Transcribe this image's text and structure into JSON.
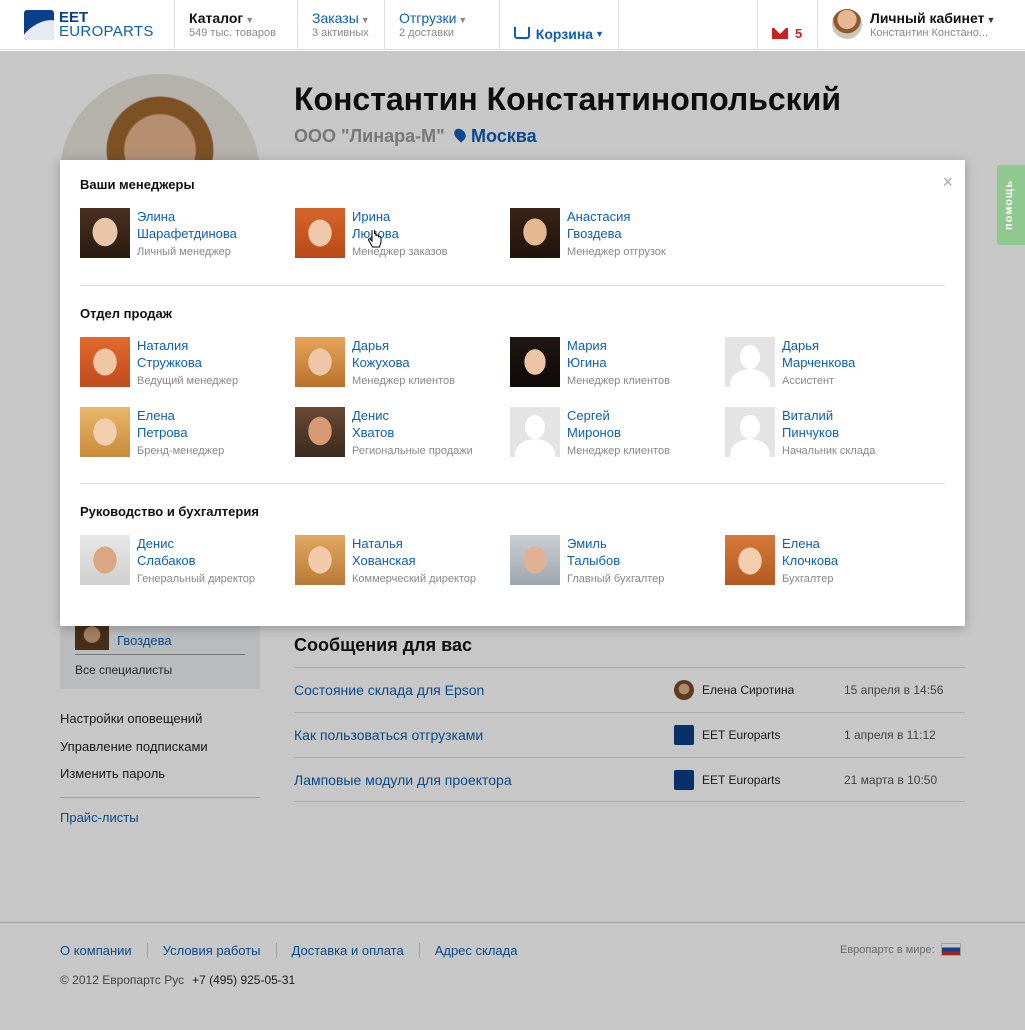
{
  "topbar": {
    "logo": {
      "line1": "EET",
      "line2": "EUROPARTS"
    },
    "catalog": {
      "title": "Каталог",
      "sub": "549 тыс. товаров"
    },
    "orders": {
      "title": "Заказы",
      "sub": "3 активных"
    },
    "shipments": {
      "title": "Отгрузки",
      "sub": "2 доставки"
    },
    "cart": {
      "title": "Корзина"
    },
    "mail": {
      "count": "5"
    },
    "account": {
      "title": "Личный кабинет",
      "sub": "Константин Констано..."
    }
  },
  "profile": {
    "name": "Константин Константинопольский",
    "company": "ООО \"Линара-М\"",
    "city": "Москва"
  },
  "help": {
    "label": "помощь"
  },
  "modal": {
    "close": "×",
    "sections": [
      {
        "title": "Ваши менеджеры",
        "people": [
          {
            "first": "Элина",
            "last": "Шарафетдинова",
            "role": "Личный менеджер",
            "photo": "ph-f1"
          },
          {
            "first": "Ирина",
            "last": "Людова",
            "role": "Менеджер заказов",
            "photo": "ph-f2"
          },
          {
            "first": "Анастасия",
            "last": "Гвоздева",
            "role": "Менеджер отгрузок",
            "photo": "ph-f3"
          }
        ]
      },
      {
        "title": "Отдел продаж",
        "people": [
          {
            "first": "Наталия",
            "last": "Стружкова",
            "role": "Ведущий менеджер",
            "photo": "ph-f4"
          },
          {
            "first": "Дарья",
            "last": "Кожухова",
            "role": "Менеджер клиентов",
            "photo": "ph-f5"
          },
          {
            "first": "Мария",
            "last": "Югина",
            "role": "Менеджер клиентов",
            "photo": "ph-f6"
          },
          {
            "first": "Дарья",
            "last": "Марченкова",
            "role": "Ассистент",
            "photo": "ph-ghost"
          },
          {
            "first": "Елена",
            "last": "Петрова",
            "role": "Бренд-менеджер",
            "photo": "ph-f7"
          },
          {
            "first": "Денис",
            "last": "Хватов",
            "role": "Региональные продажи",
            "photo": "ph-m2"
          },
          {
            "first": "Сергей",
            "last": "Миронов",
            "role": "Менеджер клиентов",
            "photo": "ph-ghost"
          },
          {
            "first": "Виталий",
            "last": "Пинчуков",
            "role": "Начальник склада",
            "photo": "ph-ghost"
          }
        ]
      },
      {
        "title": "Руководство и бухгалтерия",
        "people": [
          {
            "first": "Денис",
            "last": "Слабаков",
            "role": "Генеральный директор",
            "photo": "ph-m1"
          },
          {
            "first": "Наталья",
            "last": "Хованская",
            "role": "Коммерческий директор",
            "photo": "ph-f8"
          },
          {
            "first": "Эмиль",
            "last": "Талыбов",
            "role": "Главный бухгалтер",
            "photo": "ph-m3"
          },
          {
            "first": "Елена",
            "last": "Клочкова",
            "role": "Бухгалтер",
            "photo": "ph-f9"
          }
        ]
      }
    ]
  },
  "sidebar": {
    "manager_name": "Гвоздева",
    "all_specialists": "Все специалисты",
    "links": [
      "Настройки оповещений",
      "Управление подписками",
      "Изменить пароль"
    ],
    "price_lists": "Прайс-листы"
  },
  "messages": {
    "title": "Сообщения для вас",
    "rows": [
      {
        "subject": "Состояние склада для Epson",
        "from": "Елена Сиротина",
        "from_icon": "face",
        "date": "15 апреля в 14:56"
      },
      {
        "subject": "Как пользоваться отгрузками",
        "from": "EET Europarts",
        "from_icon": "logo",
        "date": "1 апреля в 11:12"
      },
      {
        "subject": "Ламповые модули для проектора",
        "from": "EET Europarts",
        "from_icon": "logo",
        "date": "21 марта в 10:50"
      }
    ]
  },
  "footer": {
    "links": [
      "О компании",
      "Условия работы",
      "Доставка и оплата",
      "Адрес склада"
    ],
    "copyright": "© 2012 Европартс Рус",
    "phone": "+7 (495) 925-05-31",
    "world": "Европартс в мире:"
  }
}
